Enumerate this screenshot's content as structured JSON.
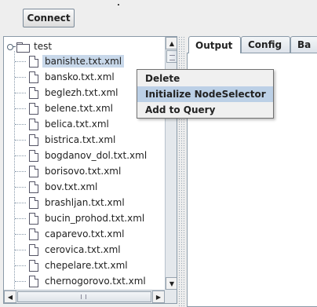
{
  "toolbar": {
    "connect_label": "Connect"
  },
  "tree": {
    "root_label": "test",
    "items": [
      {
        "label": "banishte.txt.xml"
      },
      {
        "label": "bansko.txt.xml"
      },
      {
        "label": "beglezh.txt.xml"
      },
      {
        "label": "belene.txt.xml"
      },
      {
        "label": "belica.txt.xml"
      },
      {
        "label": "bistrica.txt.xml"
      },
      {
        "label": "bogdanov_dol.txt.xml"
      },
      {
        "label": "borisovo.txt.xml"
      },
      {
        "label": "bov.txt.xml"
      },
      {
        "label": "brashljan.txt.xml"
      },
      {
        "label": "bucin_prohod.txt.xml"
      },
      {
        "label": "caparevo.txt.xml"
      },
      {
        "label": "cerovica.txt.xml"
      },
      {
        "label": "chepelare.txt.xml"
      },
      {
        "label": "chernogorovo.txt.xml"
      }
    ],
    "selected_index": 0
  },
  "tabs": [
    {
      "label": "Output"
    },
    {
      "label": "Config"
    },
    {
      "label": "Ba"
    }
  ],
  "active_tab": "Output",
  "context_menu": {
    "items": [
      {
        "label": "Delete"
      },
      {
        "label": "Initialize NodeSelector"
      },
      {
        "label": "Add to Query"
      }
    ],
    "highlighted_index": 1
  },
  "colors": {
    "selection": "#c8d8ea",
    "menu_highlight": "#bcd0e6",
    "background": "#eeeeee"
  }
}
